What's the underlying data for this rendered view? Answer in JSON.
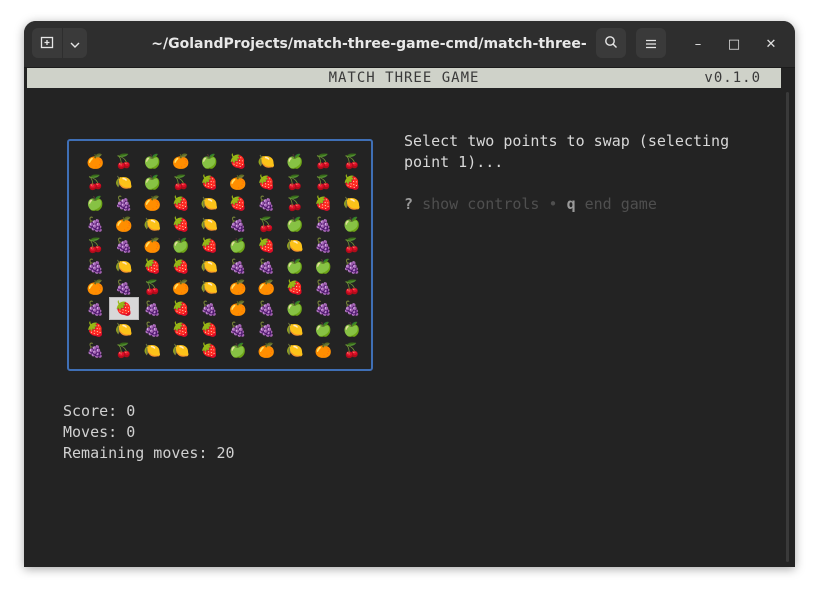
{
  "window": {
    "title": "~/GolandProjects/match-three-game-cmd/match-three-game-cmd",
    "controls": {
      "minimize": "–",
      "maximize": "□",
      "close": "✕"
    }
  },
  "app": {
    "name": "MATCH THREE GAME",
    "version": "v0.1.0",
    "prompt": "Select two points to swap (selecting point 1)...",
    "help": {
      "key1": "?",
      "label1": "show controls",
      "sep": "•",
      "key2": "q",
      "label2": "end game"
    },
    "score_label": "Score: 0",
    "moves_label": "Moves: 0",
    "remaining_label": "Remaining moves: 20"
  },
  "board": {
    "rows": [
      [
        "🍊",
        "🍒",
        "🍏",
        "🍊",
        "🍏",
        "🍓",
        "🍋",
        "🍏",
        "🍒",
        "🍒"
      ],
      [
        "🍒",
        "🍋",
        "🍏",
        "🍒",
        "🍓",
        "🍊",
        "🍓",
        "🍒",
        "🍒",
        "🍓"
      ],
      [
        "🍏",
        "🍇",
        "🍊",
        "🍓",
        "🍋",
        "🍓",
        "🍇",
        "🍒",
        "🍓",
        "🍋"
      ],
      [
        "🍇",
        "🍊",
        "🍋",
        "🍓",
        "🍋",
        "🍇",
        "🍒",
        "🍏",
        "🍇",
        "🍏"
      ],
      [
        "🍒",
        "🍇",
        "🍊",
        "🍏",
        "🍓",
        "🍏",
        "🍓",
        "🍋",
        "🍇",
        "🍒"
      ],
      [
        "🍇",
        "🍋",
        "🍓",
        "🍓",
        "🍋",
        "🍇",
        "🍇",
        "🍏",
        "🍏",
        "🍇"
      ],
      [
        "🍊",
        "🍇",
        "🍒",
        "🍊",
        "🍋",
        "🍊",
        "🍊",
        "🍓",
        "🍇",
        "🍒"
      ],
      [
        "🍇",
        "🍓",
        "🍇",
        "🍓",
        "🍇",
        "🍊",
        "🍇",
        "🍏",
        "🍇",
        "🍇"
      ],
      [
        "🍓",
        "🍋",
        "🍇",
        "🍓",
        "🍓",
        "🍇",
        "🍇",
        "🍋",
        "🍏",
        "🍏"
      ],
      [
        "🍇",
        "🍒",
        "🍋",
        "🍋",
        "🍓",
        "🍏",
        "🍊",
        "🍋",
        "🍊",
        "🍒"
      ]
    ],
    "selected": {
      "row": 7,
      "col": 1
    }
  },
  "icons": {
    "new_tab": "new-tab-icon",
    "dropdown": "chevron-down-icon",
    "search": "search-icon",
    "menu": "hamburger-menu-icon"
  },
  "colors": {
    "board_border": "#3f6fb5",
    "header_bg": "#cfd2c9",
    "terminal_bg": "#232323"
  }
}
